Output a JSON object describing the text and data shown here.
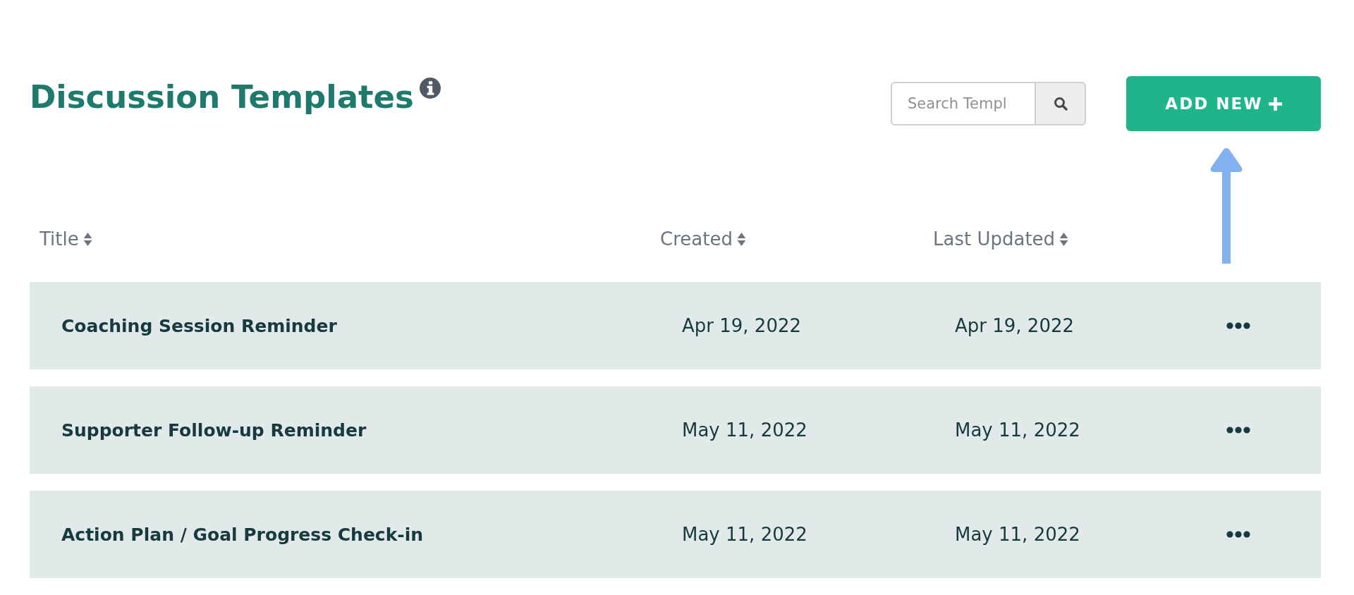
{
  "page": {
    "title": "Discussion Templates"
  },
  "search": {
    "placeholder": "Search Templ"
  },
  "add_button": {
    "label": "ADD NEW"
  },
  "annotations": [
    {
      "kind": "arrow"
    }
  ],
  "table": {
    "columns": [
      {
        "label": "Title",
        "sortable": true
      },
      {
        "label": "Created",
        "sortable": true
      },
      {
        "label": "Last Updated",
        "sortable": true
      }
    ],
    "rows": [
      {
        "title": "Coaching Session Reminder",
        "created": "Apr 19, 2022",
        "last_updated": "Apr 19, 2022"
      },
      {
        "title": "Supporter Follow-up Reminder",
        "created": "May 11, 2022",
        "last_updated": "May 11, 2022"
      },
      {
        "title": "Action Plan / Goal Progress Check-in",
        "created": "May 11, 2022",
        "last_updated": "May 11, 2022"
      }
    ]
  }
}
